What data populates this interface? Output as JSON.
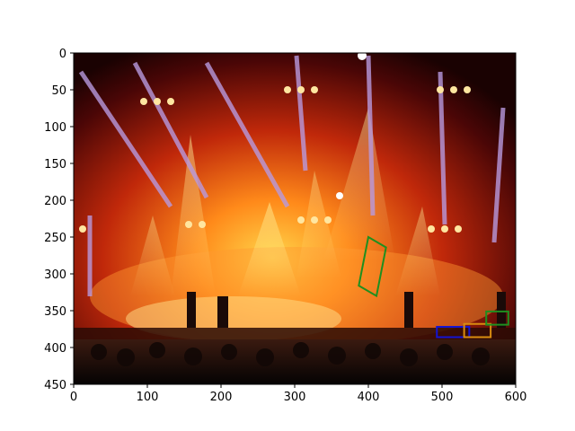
{
  "chart_data": {
    "type": "scatter",
    "title": "",
    "xlabel": "",
    "ylabel": "",
    "xlim": [
      0,
      600
    ],
    "ylim": [
      450,
      0
    ],
    "x_ticks": [
      0,
      100,
      200,
      300,
      400,
      500,
      600
    ],
    "y_ticks": [
      0,
      50,
      100,
      150,
      200,
      250,
      300,
      350,
      400,
      450
    ],
    "grid": false,
    "legend": "none",
    "image_description": "concert stage with lighting rigs and crowd",
    "annotations": [
      {
        "label": "text-box-vertical",
        "color": "#1f8f1f",
        "corners": [
          [
            400,
            250
          ],
          [
            424,
            264
          ],
          [
            411,
            330
          ],
          [
            387,
            316
          ]
        ]
      },
      {
        "label": "text-box-not",
        "color": "#1414d2",
        "corners": [
          [
            493,
            372
          ],
          [
            537,
            372
          ],
          [
            537,
            386
          ],
          [
            493,
            386
          ]
        ]
      },
      {
        "label": "text-box-stack",
        "color": "#d98c10",
        "corners": [
          [
            530,
            368
          ],
          [
            566,
            368
          ],
          [
            566,
            386
          ],
          [
            530,
            386
          ]
        ]
      },
      {
        "label": "text-box-10",
        "color": "#1f8f1f",
        "corners": [
          [
            560,
            351
          ],
          [
            590,
            351
          ],
          [
            590,
            369
          ],
          [
            560,
            369
          ]
        ]
      }
    ]
  }
}
